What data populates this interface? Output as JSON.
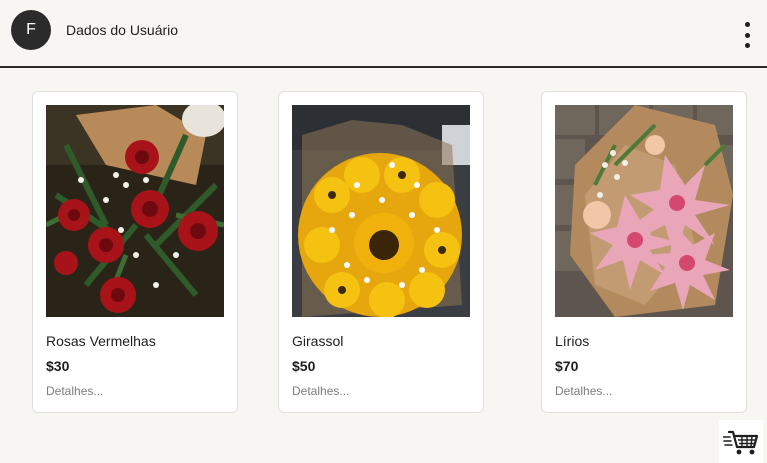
{
  "header": {
    "avatar_letter": "F",
    "user_link": "Dados do Usuário",
    "menu_icon": "more-vertical-icon"
  },
  "products": [
    {
      "name": "Rosas Vermelhas",
      "price": "$30",
      "details": "Detalhes...",
      "image": "red-roses-bouquet"
    },
    {
      "name": "Girassol",
      "price": "$50",
      "details": "Detalhes...",
      "image": "sunflower-bouquet"
    },
    {
      "name": "Lírios",
      "price": "$70",
      "details": "Detalhes...",
      "image": "pink-lilies-bouquet"
    }
  ],
  "cart": {
    "icon": "shopping-cart-icon"
  },
  "colors": {
    "background": "#f8f6f2",
    "avatar": "#2b2b2b",
    "text": "#1e1e1e",
    "muted_text": "#7d7d7d",
    "card_border": "#e2e0dc"
  }
}
